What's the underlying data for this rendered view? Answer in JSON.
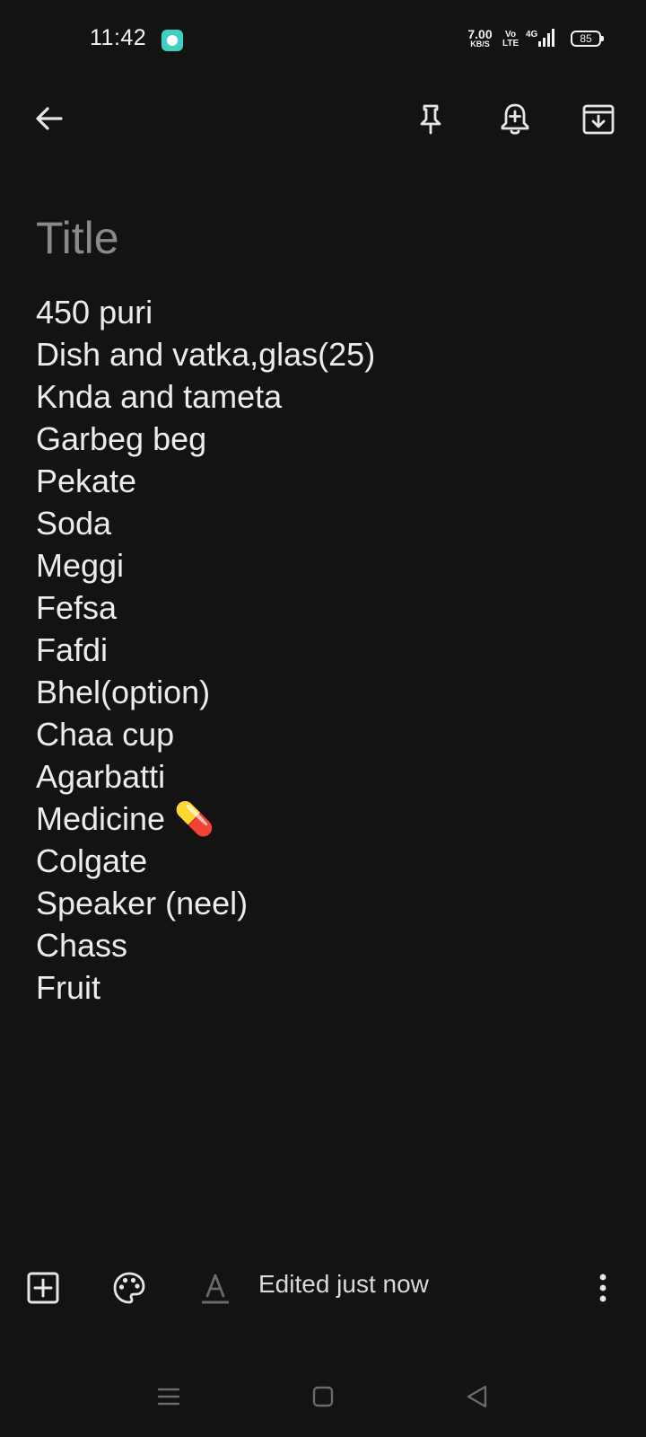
{
  "status_bar": {
    "time": "11:42",
    "net_speed_value": "7.00",
    "net_speed_unit": "KB/S",
    "volte_top": "Vo",
    "volte_bottom": "LTE",
    "network": "4G",
    "battery": "85"
  },
  "toolbar": {
    "back_icon": "arrow-back-icon",
    "pin_icon": "pin-icon",
    "reminder_icon": "bell-plus-icon",
    "archive_icon": "archive-icon"
  },
  "note": {
    "title_placeholder": "Title",
    "lines": [
      "450 puri",
      "Dish and vatka,glas(25)",
      "Knda and tameta",
      "Garbeg beg",
      "Pekate",
      "Soda",
      "Meggi",
      "Fefsa",
      "Fafdi",
      "Bhel(option)",
      "Chaa cup",
      "Agarbatti",
      "Medicine 💊",
      "Colgate",
      "Speaker (neel)",
      "Chass",
      "Fruit"
    ]
  },
  "bottom_bar": {
    "edited_label": "Edited just now"
  },
  "colors": {
    "background": "#131313",
    "text": "#ececec",
    "placeholder": "#8a8a8a",
    "icon": "#e6e6e6"
  }
}
